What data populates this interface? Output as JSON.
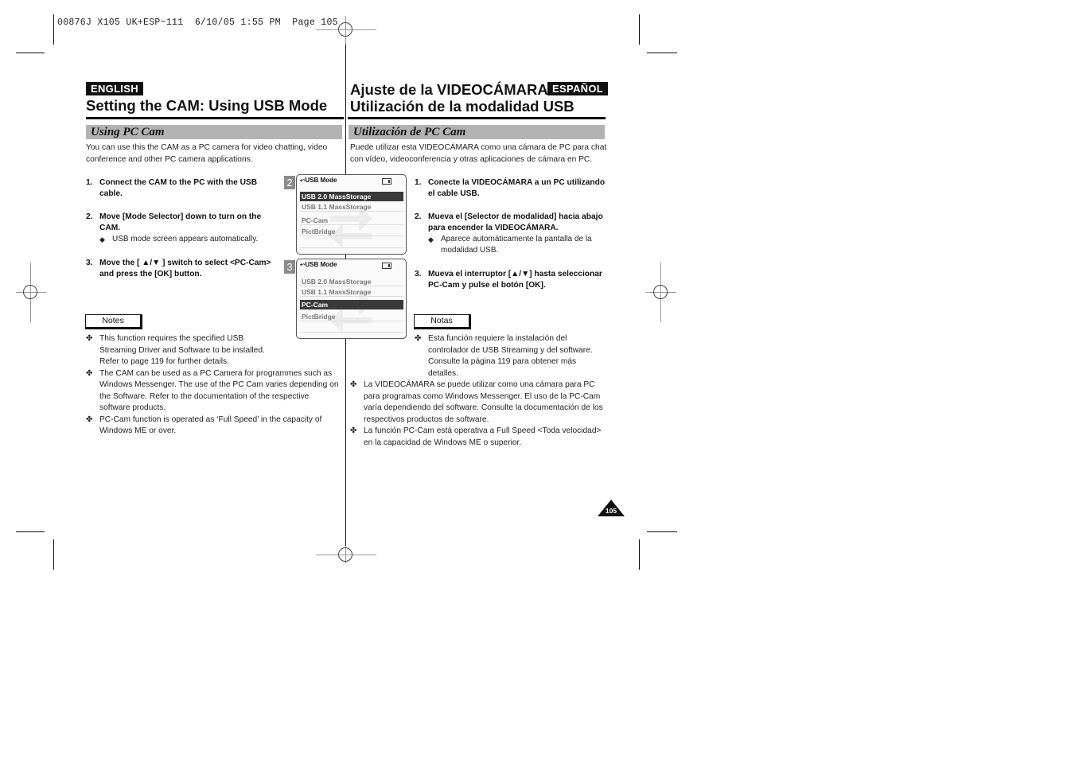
{
  "print_header": "00876J X105 UK+ESP~111  6/10/05 1:55 PM  Page 105",
  "english": {
    "lang_badge": "ENGLISH",
    "title": "Setting the CAM: Using USB Mode",
    "section": "Using PC Cam",
    "intro": [
      "You can use this the CAM as a PC camera for video chatting, video",
      "conference and other PC camera applications."
    ],
    "steps": [
      {
        "num": "1.",
        "lines": [
          "Connect the CAM to the PC with the USB",
          "cable."
        ]
      },
      {
        "num": "2.",
        "lines": [
          "Move [Mode Selector] down to turn on the",
          "CAM."
        ],
        "sub": "USB mode screen appears automatically."
      },
      {
        "num": "3.",
        "lines": [
          "Move the [ ▲/▼ ] switch to select <PC-Cam>",
          "and press the [OK] button."
        ]
      }
    ],
    "notes_label": "Notes",
    "notes": [
      [
        "This function requires the specified USB",
        "Streaming Driver and Software to be installed.",
        "Refer to page 119 for further details."
      ],
      [
        "The CAM can be used as a PC Camera for programmes such as",
        "Windows Messenger. The use of the PC Cam varies depending on",
        "the Software. Refer to the documentation of the respective",
        "software products."
      ],
      [
        "PC-Cam function is operated as ‘Full Speed’ in the capacity of",
        "Windows ME or over."
      ]
    ]
  },
  "spanish": {
    "lang_badge": "ESPAÑOL",
    "title_line1": "Ajuste de la VIDEOCÁMARA:",
    "title_line2": "Utilización de la modalidad USB",
    "section": "Utilización de PC Cam",
    "intro": [
      "Puede utilizar esta VIDEOCÁMARA como una cámara de PC para chat",
      "con vídeo, videoconferencia y otras aplicaciones de cámara en PC."
    ],
    "steps": [
      {
        "num": "1.",
        "lines": [
          "Conecte la VIDEOCÁMARA a un PC utilizando",
          "el cable USB."
        ]
      },
      {
        "num": "2.",
        "lines": [
          "Mueva el [Selector de modalidad] hacia abajo",
          "para encender la VIDEOCÁMARA."
        ],
        "sub": [
          "Aparece automáticamente la pantalla de la",
          "modalidad USB."
        ]
      },
      {
        "num": "3.",
        "lines": [
          "Mueva el interruptor [▲/▼] hasta seleccionar",
          "PC-Cam  y pulse el botón [OK]."
        ]
      }
    ],
    "notes_label": "Notas",
    "notes": [
      [
        "Esta función requiere la instalación del",
        "controlador de USB Streaming y del software.",
        "Consulte la página 119 para obtener más",
        "detalles."
      ],
      [
        "La VIDEOCÁMARA se puede utilizar como una cámara para PC",
        "para programas como Windows Messenger. El uso de la PC-Cam",
        "varía dependiendo del software. Consulte la documentación de los",
        "respectivos productos de software."
      ],
      [
        "La función PC-Cam está operativa a Full Speed <Toda velocidad>",
        "en la capacidad de Windows ME o superior."
      ]
    ]
  },
  "screens": [
    {
      "step": "2",
      "title": "USB Mode",
      "items": [
        "USB 2.0 MassStorage",
        "USB 1.1 MassStorage",
        "PC-Cam",
        "PictBridge"
      ],
      "selected": 0
    },
    {
      "step": "3",
      "title": "USB Mode",
      "items": [
        "USB 2.0 MassStorage",
        "USB 1.1 MassStorage",
        "PC-Cam",
        "PictBridge"
      ],
      "selected": 2
    }
  ],
  "icons": {
    "bullet": "◆",
    "note_marker": "✤",
    "usb": "usb-icon",
    "battery": "battery-icon",
    "usb_glyph": "⮂"
  },
  "page_number": "105"
}
